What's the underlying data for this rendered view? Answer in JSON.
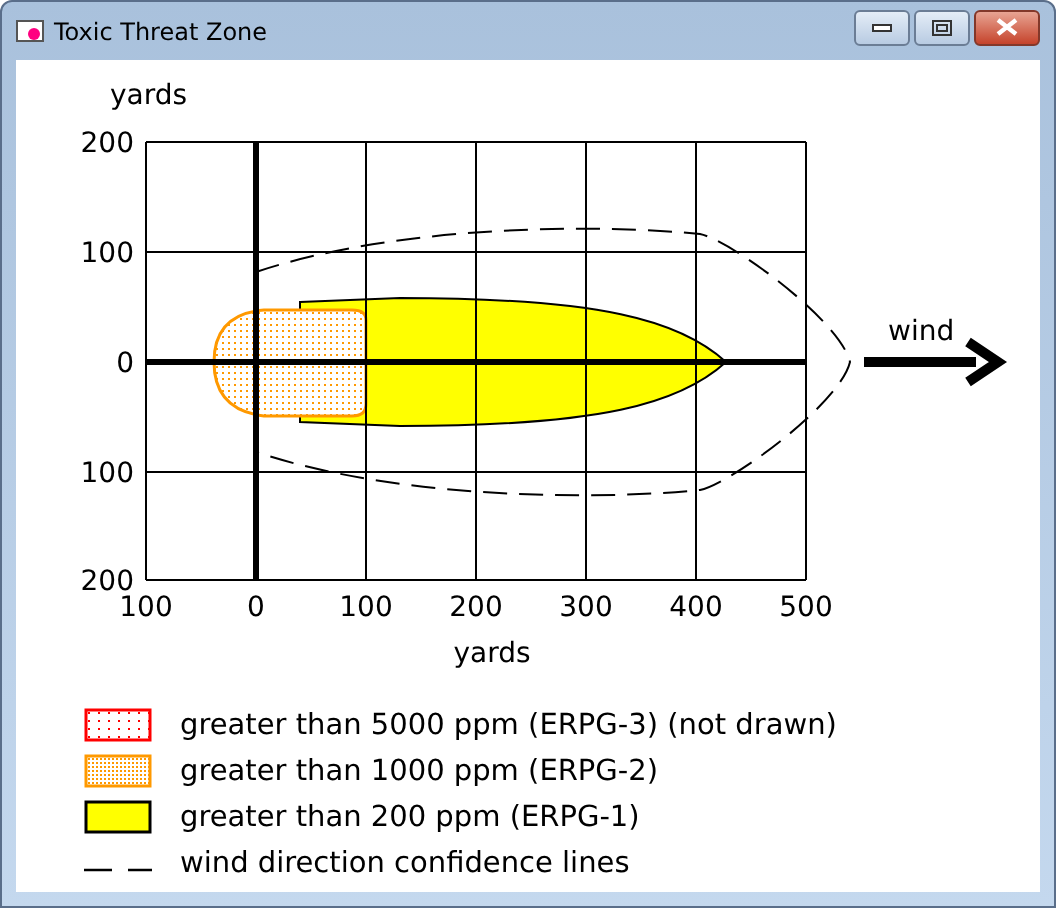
{
  "window": {
    "title": "Toxic Threat Zone"
  },
  "plot": {
    "y_unit": "yards",
    "x_unit": "yards",
    "y_ticks": [
      "200",
      "100",
      "0",
      "100",
      "200"
    ],
    "x_ticks": [
      "100",
      "0",
      "100",
      "200",
      "300",
      "400",
      "500"
    ],
    "wind_label": "wind"
  },
  "legend": [
    {
      "kind": "sparse",
      "color": "#ff0000",
      "label": "greater than 5000 ppm (ERPG-3) (not drawn)"
    },
    {
      "kind": "dense",
      "color": "#ff9900",
      "label": "greater than 1000 ppm (ERPG-2)"
    },
    {
      "kind": "solid",
      "color": "#ffff00",
      "label": "greater than 200 ppm (ERPG-1)"
    },
    {
      "kind": "dashed",
      "color": "#000000",
      "label": "wind direction confidence lines"
    }
  ]
}
